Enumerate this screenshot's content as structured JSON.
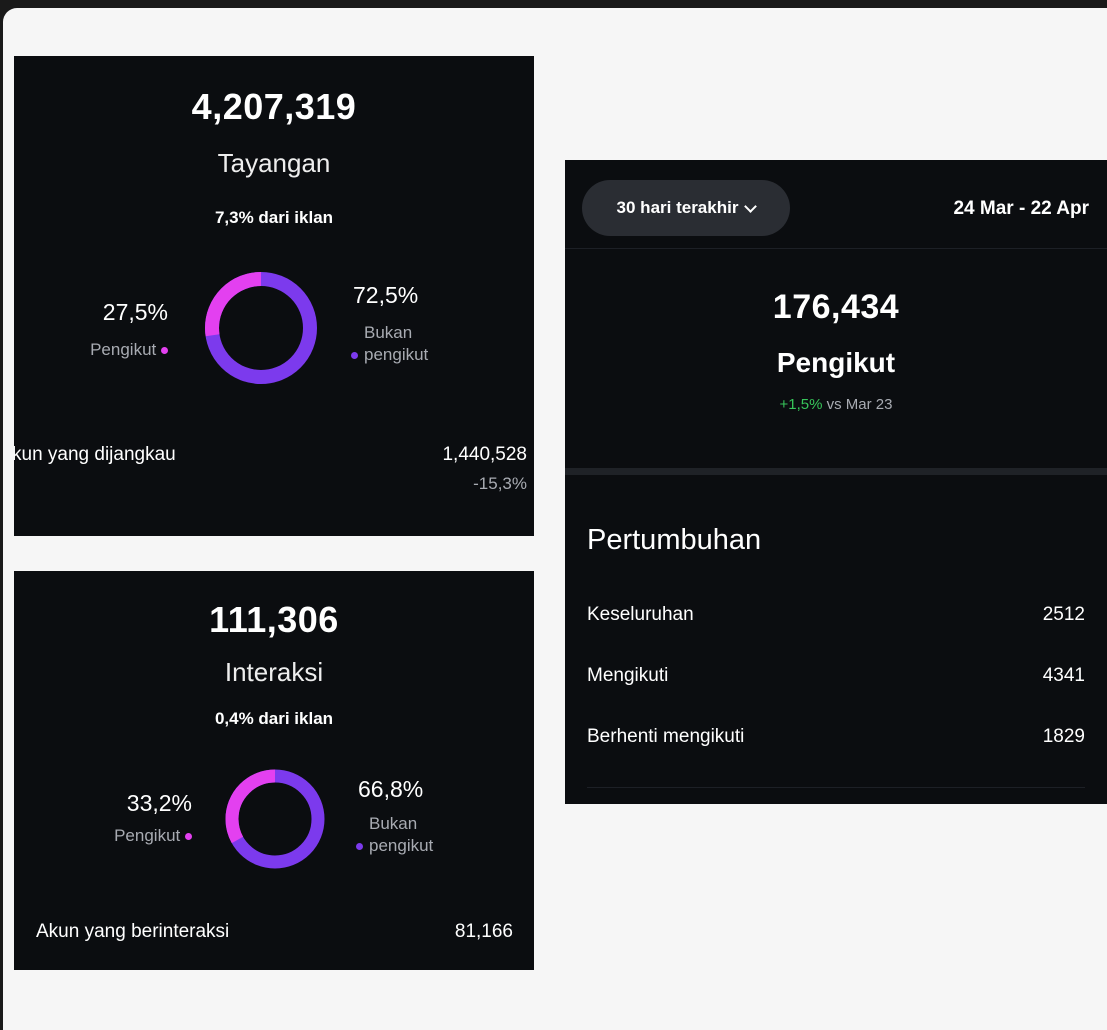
{
  "views_card": {
    "total": "4,207,319",
    "label": "Tayangan",
    "ads_note": "7,3% dari iklan",
    "followers_pct": "27,5%",
    "followers_label": "Pengikut",
    "non_followers_pct": "72,5%",
    "non_followers_label_1": "Bukan",
    "non_followers_label_2": "pengikut",
    "followers_share": 0.275,
    "reach_label": "kun yang dijangkau",
    "reach_value": "1,440,528",
    "reach_change": "-15,3%"
  },
  "interactions_card": {
    "total": "111,306",
    "label": "Interaksi",
    "ads_note": "0,4% dari iklan",
    "followers_pct": "33,2%",
    "followers_label": "Pengikut",
    "non_followers_pct": "66,8%",
    "non_followers_label_1": "Bukan",
    "non_followers_label_2": "pengikut",
    "followers_share": 0.332,
    "engaged_label": "Akun yang berinteraksi",
    "engaged_value": "81,166"
  },
  "followers_card": {
    "period_button": "30 hari terakhir",
    "date_range": "24 Mar - 22 Apr",
    "total": "176,434",
    "label": "Pengikut",
    "change": "+1,5%",
    "change_suffix": "vs Mar 23",
    "growth_title": "Pertumbuhan",
    "growth_rows": [
      {
        "label": "Keseluruhan",
        "value": "2512"
      },
      {
        "label": "Mengikuti",
        "value": "4341"
      },
      {
        "label": "Berhenti mengikuti",
        "value": "1829"
      }
    ]
  },
  "colors": {
    "card_bg": "#0b0d10",
    "followers_pink": "#e340f0",
    "non_followers_purple": "#7c3aed",
    "positive_green": "#37c45a"
  }
}
